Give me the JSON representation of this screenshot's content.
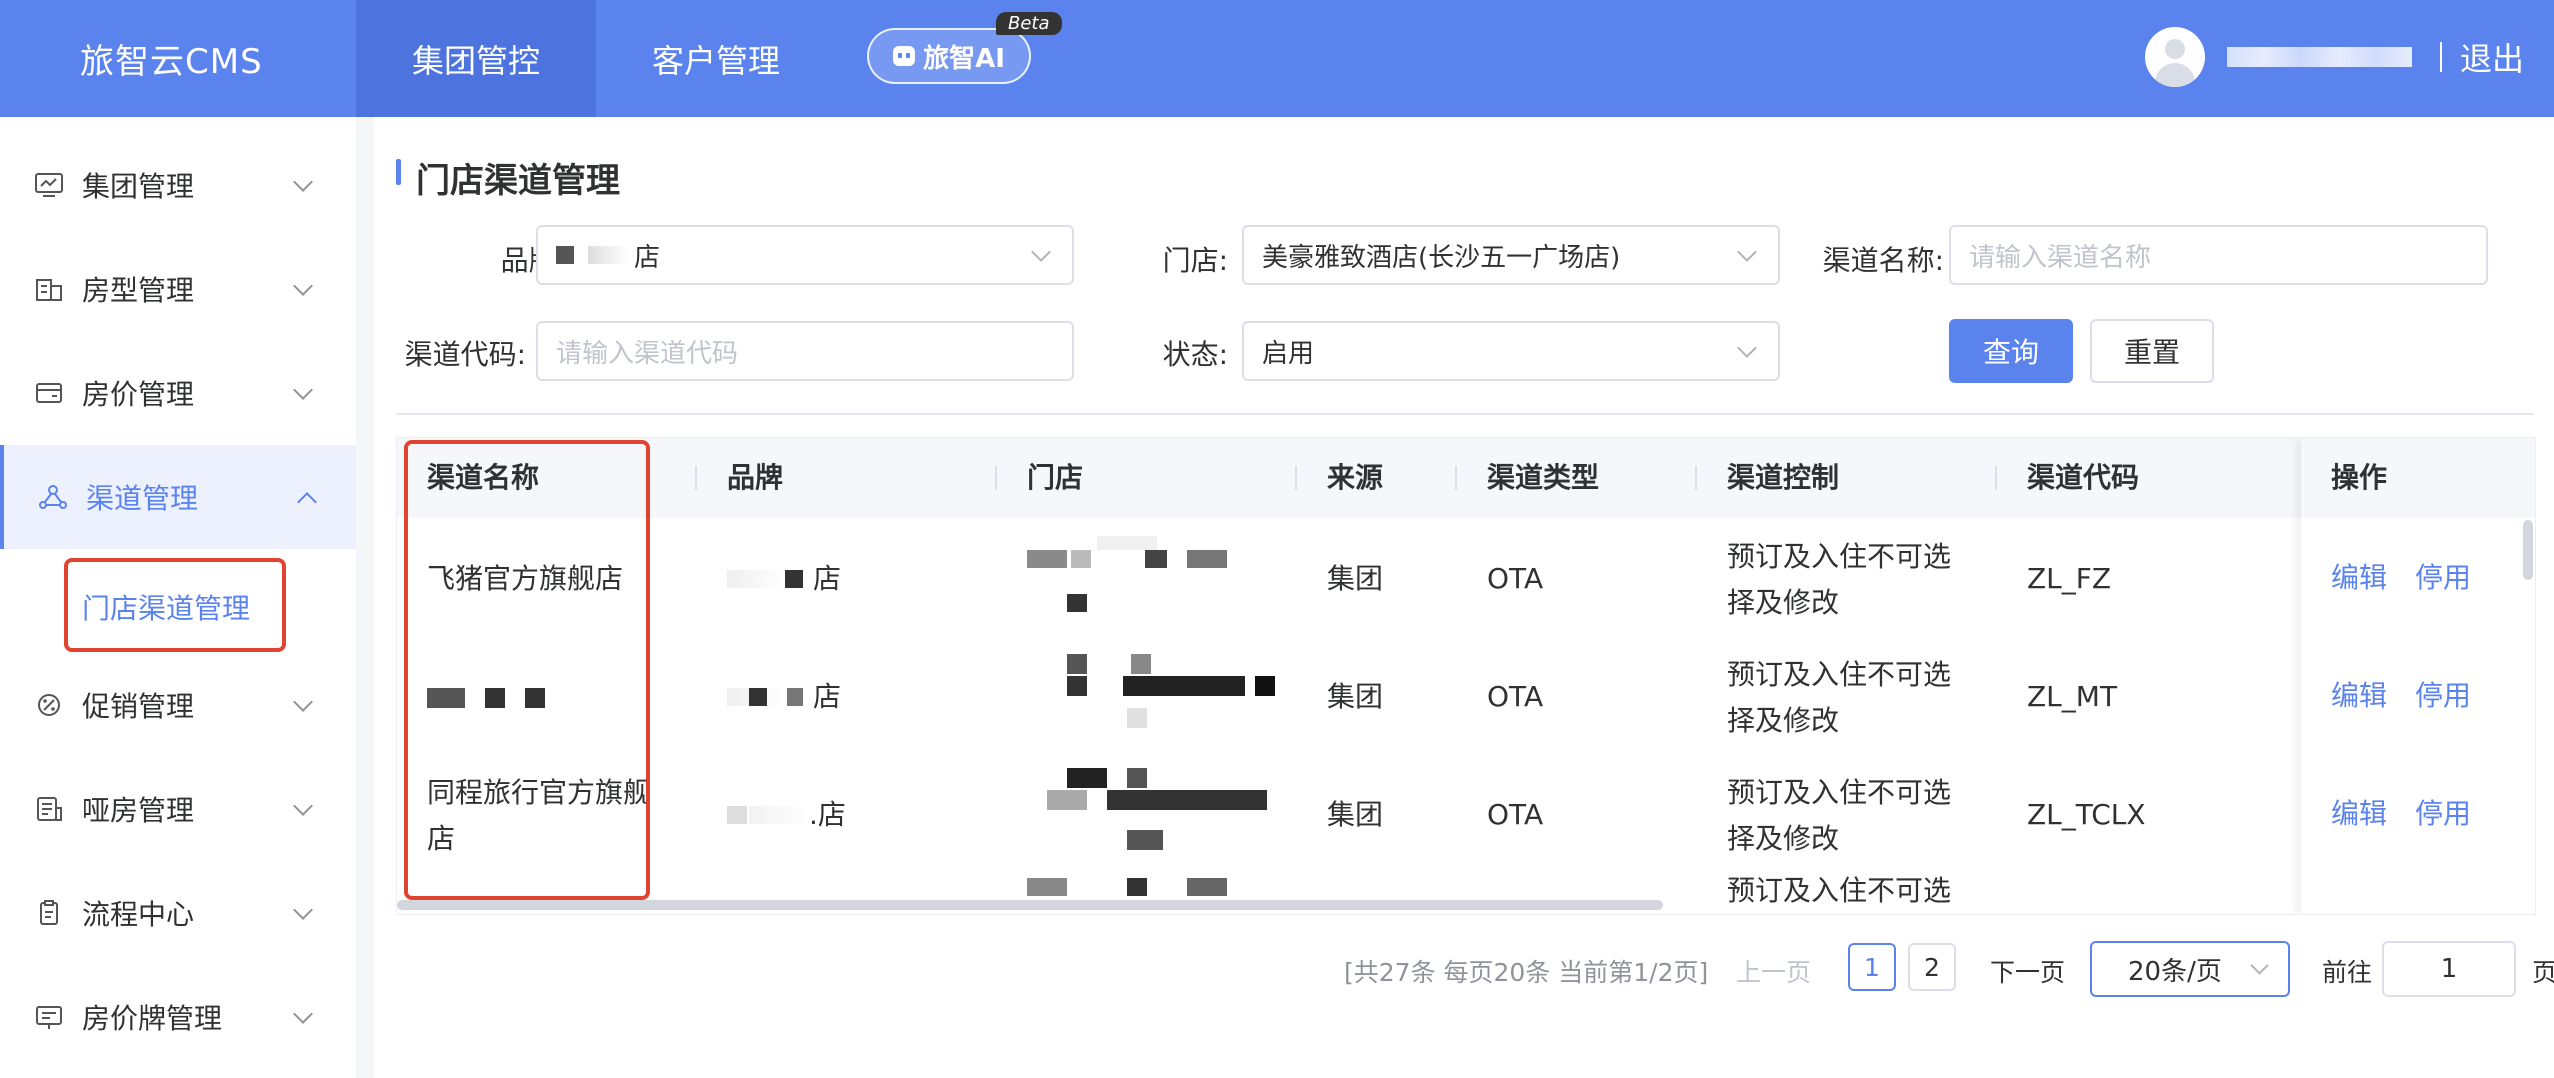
{
  "app": {
    "title": "旅智云CMS"
  },
  "topnav": {
    "items": [
      "集团管控",
      "客户管理"
    ],
    "ai_label": "旅智AI",
    "beta": "Beta",
    "logout": "退出"
  },
  "sidebar": {
    "items": [
      {
        "label": "集团管理",
        "icon": "chart-board-icon"
      },
      {
        "label": "房型管理",
        "icon": "building-icon"
      },
      {
        "label": "房价管理",
        "icon": "wallet-icon"
      },
      {
        "label": "渠道管理",
        "icon": "network-icon"
      },
      {
        "label": "促销管理",
        "icon": "promotion-icon"
      },
      {
        "label": "哑房管理",
        "icon": "list-doc-icon"
      },
      {
        "label": "流程中心",
        "icon": "clipboard-icon"
      },
      {
        "label": "房价牌管理",
        "icon": "price-board-icon"
      }
    ],
    "sub_item": "门店渠道管理"
  },
  "page": {
    "title": "门店渠道管理"
  },
  "filters": {
    "brand_label": "品牌:",
    "brand_value": "店",
    "store_label": "门店:",
    "store_value": "美豪雅致酒店(长沙五一广场店)",
    "channel_name_label": "渠道名称:",
    "channel_name_placeholder": "请输入渠道名称",
    "channel_code_label": "渠道代码:",
    "channel_code_placeholder": "请输入渠道代码",
    "status_label": "状态:",
    "status_value": "启用",
    "query": "查询",
    "reset": "重置"
  },
  "table": {
    "headers": [
      "渠道名称",
      "品牌",
      "门店",
      "来源",
      "渠道类型",
      "渠道控制",
      "渠道代码",
      "操作"
    ],
    "rows": [
      {
        "name": "飞猪官方旗舰店",
        "brand": "店",
        "source": "集团",
        "type": "OTA",
        "control_1": "预订及入住不可选",
        "control_2": "择及修改",
        "code": "ZL_FZ",
        "edit": "编辑",
        "disable": "停用"
      },
      {
        "name": "",
        "brand": "店",
        "source": "集团",
        "type": "OTA",
        "control_1": "预订及入住不可选",
        "control_2": "择及修改",
        "code": "ZL_MT",
        "edit": "编辑",
        "disable": "停用"
      },
      {
        "name": "同程旅行官方旗舰",
        "name_2": "店",
        "brand": ".店",
        "source": "集团",
        "type": "OTA",
        "control_1": "预订及入住不可选",
        "control_2": "择及修改",
        "code": "ZL_TCLX",
        "edit": "编辑",
        "disable": "停用"
      }
    ],
    "partial_row_text": "预订及入住不可选"
  },
  "pagination": {
    "summary": "[共27条 每页20条 当前第1/2页]",
    "prev": "上一页",
    "pages": [
      "1",
      "2"
    ],
    "next": "下一页",
    "size": "20条/页",
    "goto": "前往",
    "goto_value": "1",
    "page_unit": "页"
  },
  "colors": {
    "primary": "#5b83ee",
    "highlight_box": "#e0432f"
  }
}
